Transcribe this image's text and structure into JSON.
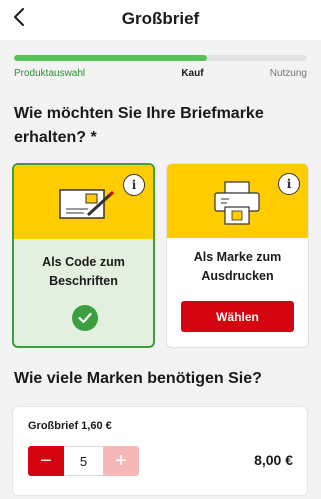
{
  "header": {
    "title": "Großbrief",
    "back_icon": "chevron-left-icon"
  },
  "progress": {
    "fraction": 0.66,
    "fill_color": "#57c25a",
    "steps": [
      "Produktauswahl",
      "Kauf",
      "Nutzung"
    ]
  },
  "delivery": {
    "question": "Wie möchten Sie Ihre Briefmarke erhalten? *",
    "options": [
      {
        "label": "Als Code zum Beschriften",
        "selected": true,
        "icon": "letter-code-icon",
        "info_icon": "info-icon"
      },
      {
        "label": "Als Marke zum Ausdrucken",
        "selected": false,
        "icon": "printer-icon",
        "info_icon": "info-icon",
        "button_label": "Wählen"
      }
    ]
  },
  "quantity": {
    "question": "Wie viele Marken benötigen Sie?",
    "product_label": "Großbrief 1,60 €",
    "value": "5",
    "minus": "−",
    "plus": "+",
    "total": "8,00 €"
  },
  "colors": {
    "brand_yellow": "#ffcc00",
    "brand_red": "#d40511",
    "success_green": "#3aa03f"
  }
}
